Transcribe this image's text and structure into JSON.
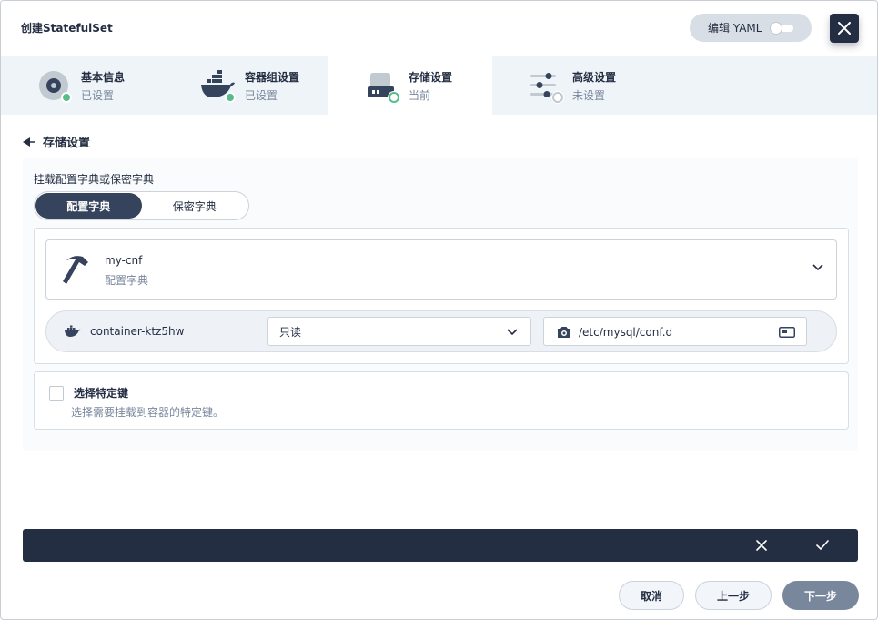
{
  "header": {
    "title": "创建StatefulSet",
    "yaml_label": "编辑 YAML",
    "close_icon": "close-icon"
  },
  "steps": [
    {
      "title": "基本信息",
      "status": "已设置",
      "icon": "disc-icon",
      "state": "done"
    },
    {
      "title": "容器组设置",
      "status": "已设置",
      "icon": "docker-icon",
      "state": "done"
    },
    {
      "title": "存储设置",
      "status": "当前",
      "icon": "storage-icon",
      "state": "current"
    },
    {
      "title": "高级设置",
      "status": "未设置",
      "icon": "sliders-icon",
      "state": "todo"
    }
  ],
  "section": {
    "title": "存储设置",
    "mount_label": "挂载配置字典或保密字典",
    "tabs": [
      {
        "label": "配置字典",
        "active": true
      },
      {
        "label": "保密字典",
        "active": false
      }
    ],
    "selected": {
      "name": "my-cnf",
      "type": "配置字典"
    },
    "container": {
      "name": "container-ktz5hw",
      "mode": "只读",
      "mount_path": "/etc/mysql/conf.d"
    },
    "specific_keys": {
      "title": "选择特定键",
      "description": "选择需要挂载到容器的特定键。",
      "checked": false
    }
  },
  "footer": {
    "cancel": "取消",
    "prev": "上一步",
    "next": "下一步"
  },
  "colors": {
    "primary_dark": "#242e42",
    "success": "#55bc8a",
    "muted": "#79879c",
    "steps_bg": "#eff4f9"
  }
}
